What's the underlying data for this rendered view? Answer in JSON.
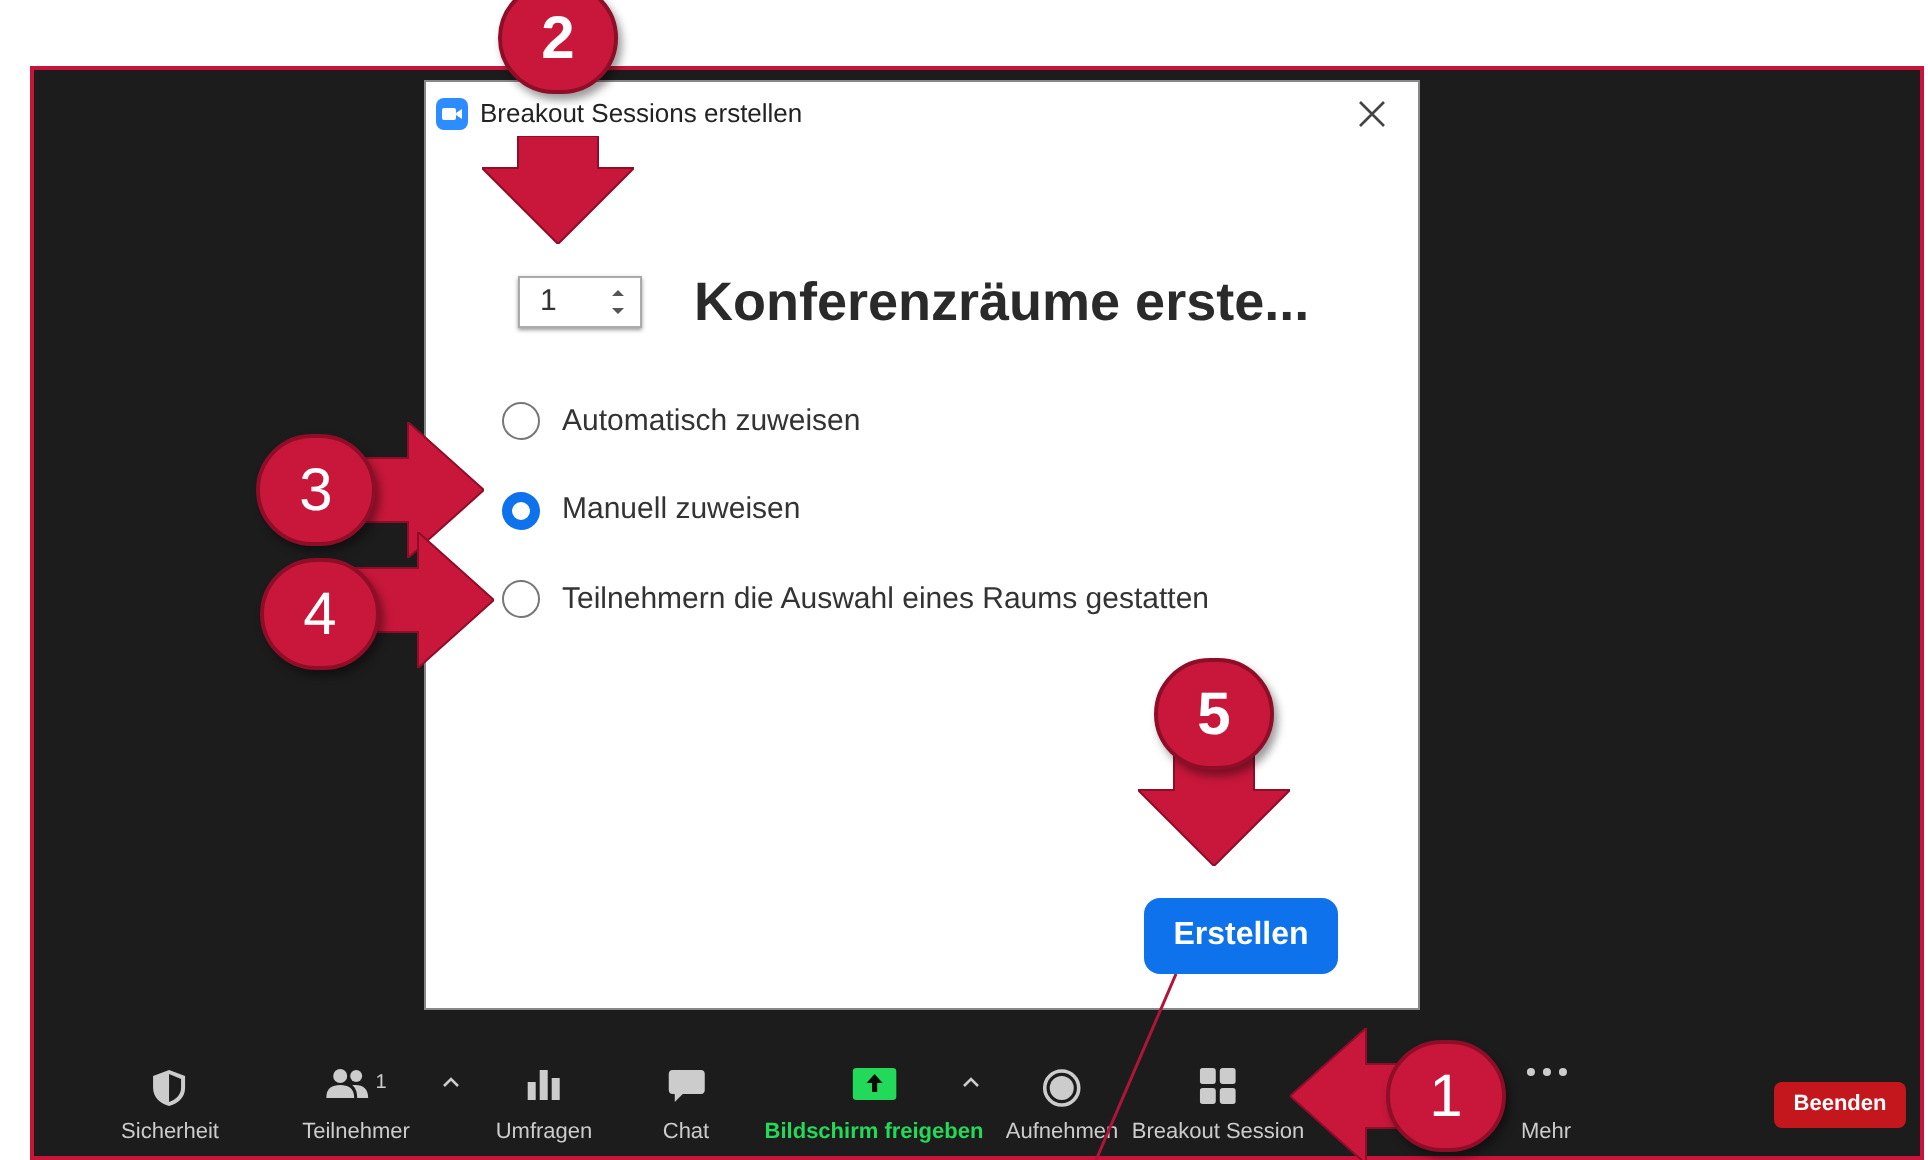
{
  "dialog": {
    "title": "Breakout Sessions erstellen",
    "room_count": "1",
    "heading": "Konferenzräume erste...",
    "options": [
      {
        "label": "Automatisch zuweisen",
        "selected": false
      },
      {
        "label": "Manuell zuweisen",
        "selected": true
      },
      {
        "label": "Teilnehmern die Auswahl eines Raums gestatten",
        "selected": false
      }
    ],
    "button": "Erstellen"
  },
  "toolbar": {
    "items": [
      {
        "label": "Sicherheit",
        "kind": "shield",
        "has_menu": false
      },
      {
        "label": "Teilnehmer",
        "kind": "people",
        "count": "1",
        "has_menu": true
      },
      {
        "label": "Umfragen",
        "kind": "poll",
        "has_menu": false
      },
      {
        "label": "Chat",
        "kind": "chat",
        "has_menu": false
      },
      {
        "label": "Bildschirm freigeben",
        "kind": "share",
        "has_menu": true
      },
      {
        "label": "Aufnehmen",
        "kind": "record",
        "has_menu": false
      },
      {
        "label": "Breakout Session",
        "kind": "grid",
        "has_menu": false
      },
      {
        "label": "Mehr",
        "kind": "more",
        "has_menu": false
      }
    ],
    "end_button": "Beenden"
  },
  "callouts": [
    {
      "label": "1",
      "kind": "left"
    },
    {
      "label": "2",
      "kind": "down"
    },
    {
      "label": "3",
      "kind": "right"
    },
    {
      "label": "4",
      "kind": "right"
    },
    {
      "label": "5",
      "kind": "down"
    }
  ]
}
